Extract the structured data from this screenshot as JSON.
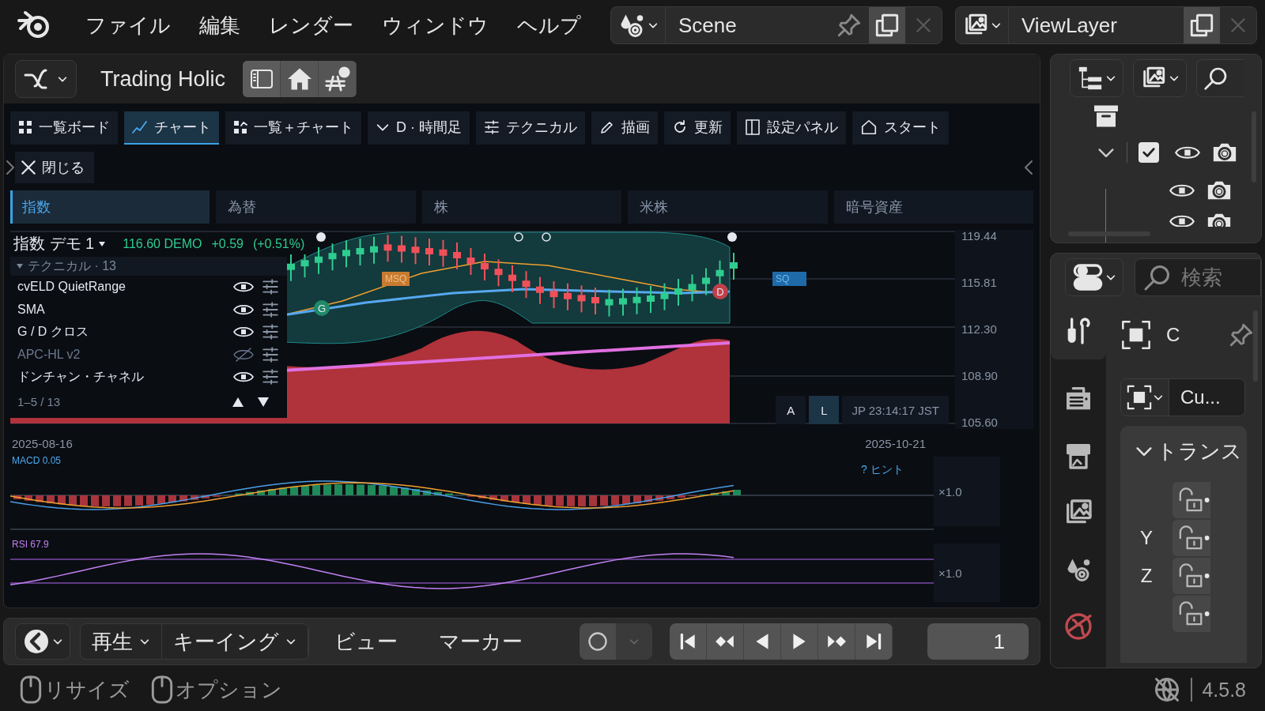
{
  "menubar": {
    "menus": [
      "ファイル",
      "編集",
      "レンダー",
      "ウィンドウ",
      "ヘルプ"
    ],
    "scene": "Scene",
    "view_layer": "ViewLayer"
  },
  "editor": {
    "title": "Trading Holic",
    "toolbar": [
      {
        "kind": "grid",
        "label": "一覧ボード",
        "selected": false
      },
      {
        "kind": "chart",
        "label": "チャート",
        "selected": true
      },
      {
        "kind": "mixed",
        "label": "一覧＋チャート",
        "selected": false
      },
      {
        "kind": "dropdown",
        "label": "D · 時間足",
        "selected": false
      },
      {
        "kind": "sliders",
        "label": "テクニカル",
        "selected": false
      },
      {
        "kind": "pencil",
        "label": "描画",
        "selected": false
      },
      {
        "kind": "refresh",
        "label": "更新",
        "selected": false
      },
      {
        "kind": "panel",
        "label": "設定パネル",
        "selected": false
      },
      {
        "kind": "home",
        "label": "スタート",
        "selected": false
      }
    ],
    "close_label": "閉じる",
    "categories": [
      {
        "label": "指数",
        "selected": true
      },
      {
        "label": "為替",
        "selected": false
      },
      {
        "label": "株",
        "selected": false
      },
      {
        "label": "米株",
        "selected": false
      },
      {
        "label": "暗号資産",
        "selected": false
      }
    ],
    "chart": {
      "symbol": "指数 デモ 1",
      "price": "116.60 DEMO",
      "change": "+0.59",
      "change_pct": "(+0.51%)",
      "price_axis": [
        "119.44",
        "115.81",
        "112.30",
        "108.90",
        "105.60"
      ],
      "msq_label": "MSQ",
      "sq_label": "SQ",
      "cross_marks": [
        {
          "kind": "golden",
          "label": "G"
        },
        {
          "kind": "dead",
          "label": "D"
        }
      ],
      "modes": [
        {
          "label": "A",
          "selected": false
        },
        {
          "label": "L",
          "selected": true
        }
      ],
      "clock": "JP 23:14:17 JST",
      "date_start": "2025-08-16",
      "date_end": "2025-10-21"
    },
    "technicals": {
      "header": "テクニカル · 13",
      "items": [
        {
          "name": "cvELD QuietRange",
          "visible": true
        },
        {
          "name": "SMA",
          "visible": true
        },
        {
          "name": "G / D クロス",
          "visible": true
        },
        {
          "name": "APC-HL v2",
          "visible": false
        },
        {
          "name": "ドンチャン・チャネル",
          "visible": true
        }
      ],
      "page": "1–5 / 13"
    },
    "macd": {
      "label": "MACD 0.05",
      "hint": "? ヒント",
      "scale": "×1.0"
    },
    "rsi": {
      "label": "RSI 67.9",
      "scale": "×1.0"
    }
  },
  "outliner": {
    "collection_checked": true
  },
  "properties": {
    "tabs": [
      {
        "kind": "tool",
        "selected": true
      },
      {
        "kind": "render",
        "selected": false
      },
      {
        "kind": "output",
        "selected": false
      },
      {
        "kind": "view_layer",
        "selected": false
      },
      {
        "kind": "scene",
        "selected": false
      },
      {
        "kind": "world",
        "selected": false
      }
    ],
    "search_placeholder": "検索",
    "object_name": "C",
    "data_name": "Cu...",
    "panel_title": "トランス",
    "panel_expanded": true,
    "axis_labels": [
      "Y",
      "Z"
    ]
  },
  "timeline": {
    "menus": [
      {
        "label": "再生",
        "dropdown": true
      },
      {
        "label": "キーイング",
        "dropdown": true
      },
      {
        "label": "ビュー",
        "dropdown": false
      },
      {
        "label": "マーカー",
        "dropdown": false
      }
    ],
    "frame": "1"
  },
  "status_bar": {
    "hints": [
      "リサイズ",
      "オプション"
    ],
    "version": "4.5.8"
  }
}
